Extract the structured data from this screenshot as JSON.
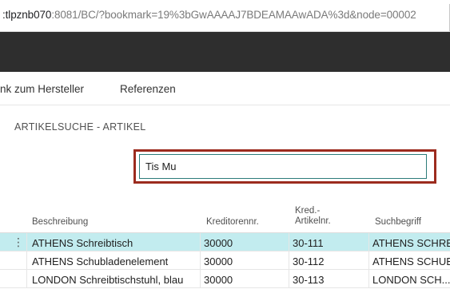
{
  "browser": {
    "url_host": ":tlpznb070",
    "url_path": ":8081/BC/?bookmark=19%3bGwAAAAJ7BDEAMAAwADA%3d&node=00002"
  },
  "actions": {
    "link_manufacturer": "nk zum Hersteller",
    "references": "Referenzen"
  },
  "page": {
    "title": "ARTIKELSUCHE - ARTIKEL"
  },
  "search": {
    "value": "Tis Mu"
  },
  "table": {
    "columns": {
      "description": "Beschreibung",
      "vendor_no": "Kreditorennr.",
      "vendor_item_no_line1": "Kred.-",
      "vendor_item_no_line2": "Artikelnr.",
      "search_term": "Suchbegriff"
    },
    "rows": [
      {
        "description": "ATHENS Schreibtisch",
        "vendor_no": "30000",
        "vendor_item_no": "30-111",
        "search_term": "ATHENS SCHREI"
      },
      {
        "description": "ATHENS Schubladenelement",
        "vendor_no": "30000",
        "vendor_item_no": "30-112",
        "search_term": "ATHENS SCHUB"
      },
      {
        "description": "LONDON Schreibtischstuhl, blau",
        "vendor_no": "30000",
        "vendor_item_no": "30-113",
        "search_term": "LONDON SCH..."
      }
    ],
    "row_menu_glyph": "⋮"
  },
  "colors": {
    "highlight_border": "#9c2b1e",
    "selected_row": "#c2ecef",
    "dark_bar": "#2e2e2e"
  }
}
